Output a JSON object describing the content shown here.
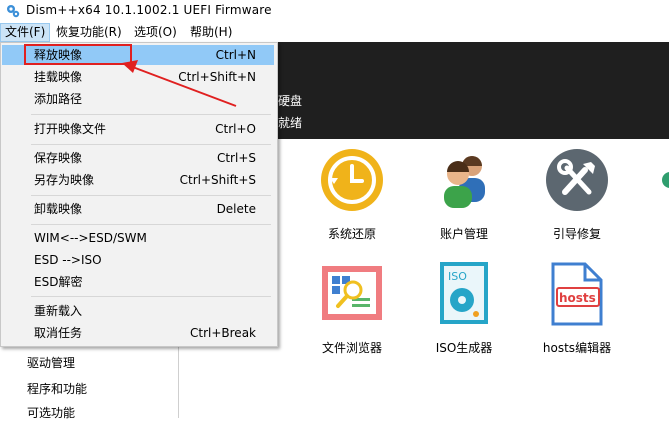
{
  "window": {
    "title": "Dism++x64 10.1.1002.1 UEFI Firmware"
  },
  "menubar": {
    "items": [
      "文件(F)",
      "恢复功能(R)",
      "选项(O)",
      "帮助(H)"
    ]
  },
  "header": {
    "line1": "硬盘",
    "line2": "就绪"
  },
  "dropdown": {
    "items": [
      {
        "label": "释放映像",
        "shortcut": "Ctrl+N"
      },
      {
        "label": "挂载映像",
        "shortcut": "Ctrl+Shift+N"
      },
      {
        "label": "添加路径",
        "shortcut": ""
      },
      {
        "label": "打开映像文件",
        "shortcut": "Ctrl+O"
      },
      {
        "label": "保存映像",
        "shortcut": "Ctrl+S"
      },
      {
        "label": "另存为映像",
        "shortcut": "Ctrl+Shift+S"
      },
      {
        "label": "卸载映像",
        "shortcut": "Delete"
      },
      {
        "label": "WIM<-->ESD/SWM",
        "shortcut": ""
      },
      {
        "label": "ESD -->ISO",
        "shortcut": ""
      },
      {
        "label": "ESD解密",
        "shortcut": ""
      },
      {
        "label": "重新载入",
        "shortcut": ""
      },
      {
        "label": "取消任务",
        "shortcut": "Ctrl+Break"
      }
    ]
  },
  "sidebar": {
    "items": [
      "驱动管理",
      "程序和功能",
      "可选功能"
    ]
  },
  "tools": [
    {
      "label": "系统还原",
      "icon": "clock-restore-icon"
    },
    {
      "label": "账户管理",
      "icon": "users-icon"
    },
    {
      "label": "引导修复",
      "icon": "tools-icon"
    },
    {
      "label": "文件浏览器",
      "icon": "file-browser-icon"
    },
    {
      "label": "ISO生成器",
      "icon": "iso-disc-icon"
    },
    {
      "label": "hosts编辑器",
      "icon": "hosts-file-icon"
    }
  ],
  "hosts_icon_text": "hosts",
  "iso_icon_text": "ISO",
  "colors": {
    "accent_highlight": "#91c9f7",
    "annotation": "#e02020",
    "header_band": "#1f1f1f"
  }
}
